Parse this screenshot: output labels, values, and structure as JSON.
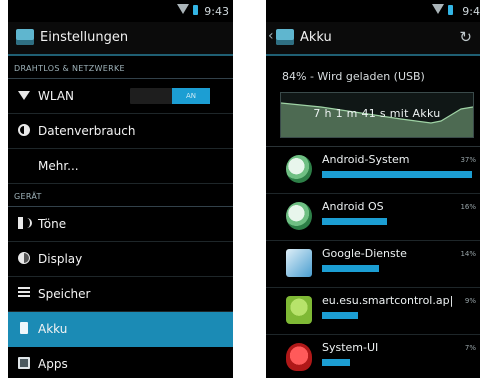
{
  "left": {
    "status_time": "9:43",
    "title": "Einstellungen",
    "section_wireless": "DRAHTLOS & NETZWERKE",
    "wlan": {
      "label": "WLAN",
      "toggle_text": "AN"
    },
    "data_usage": "Datenverbrauch",
    "more": "Mehr...",
    "section_device": "GERÄT",
    "sound": "Töne",
    "display": "Display",
    "storage": "Speicher",
    "battery": "Akku",
    "apps": "Apps"
  },
  "right": {
    "status_time": "9:4",
    "title": "Akku",
    "battery_status": "84% - Wird geladen (USB)",
    "graph_label": "7 h 1 m 41 s mit Akku",
    "apps": [
      {
        "name": "Android-System",
        "percent": "37%",
        "value": 37,
        "icon": "android-system-icon"
      },
      {
        "name": "Android OS",
        "percent": "16%",
        "value": 16,
        "icon": "android-os-icon"
      },
      {
        "name": "Google-Dienste",
        "percent": "14%",
        "value": 14,
        "icon": "google-services-icon"
      },
      {
        "name": "eu.esu.smartcontrol.ap|",
        "percent": "9%",
        "value": 9,
        "icon": "android-app-icon"
      },
      {
        "name": "System-UI",
        "percent": "7%",
        "value": 7,
        "icon": "system-ui-icon"
      }
    ],
    "accent": "#1c9ed3"
  }
}
